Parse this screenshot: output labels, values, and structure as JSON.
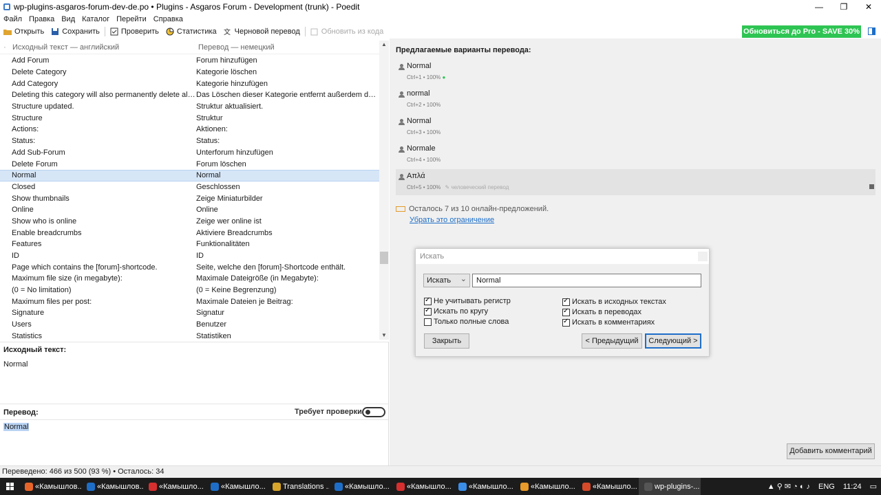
{
  "window": {
    "title": "wp-plugins-asgaros-forum-dev-de.po • Plugins - Asgaros Forum - Development (trunk) - Poedit",
    "minimize": "—",
    "maximize": "❐",
    "close": "✕"
  },
  "menu": [
    "Файл",
    "Правка",
    "Вид",
    "Каталог",
    "Перейти",
    "Справка"
  ],
  "toolbar": {
    "open": "Открыть",
    "save": "Сохранить",
    "validate": "Проверить",
    "stats": "Статистика",
    "pretranslate": "Черновой перевод",
    "update": "Обновить из кода",
    "pro": "Обновиться до Pro - SAVE 30%"
  },
  "list": {
    "header_dot": "·",
    "col_source": "Исходный текст — английский",
    "col_translation": "Перевод — немецкий",
    "rows": [
      {
        "source": "Add Forum",
        "translation": "Forum hinzufügen"
      },
      {
        "source": "Delete Category",
        "translation": "Kategorie löschen"
      },
      {
        "source": "Add Category",
        "translation": "Kategorie hinzufügen"
      },
      {
        "source": "Deleting this category will also permanently delete all for...",
        "translation": "Das Löschen dieser Kategorie entfernt außerdem dauerhaf..."
      },
      {
        "source": "Structure updated.",
        "translation": "Struktur aktualisiert."
      },
      {
        "source": "Structure",
        "translation": "Struktur"
      },
      {
        "source": "Actions:",
        "translation": "Aktionen:"
      },
      {
        "source": "Status:",
        "translation": "Status:"
      },
      {
        "source": "Add Sub-Forum",
        "translation": "Unterforum hinzufügen"
      },
      {
        "source": "Delete Forum",
        "translation": "Forum löschen"
      },
      {
        "source": "Normal",
        "translation": "Normal"
      },
      {
        "source": "Closed",
        "translation": "Geschlossen"
      },
      {
        "source": "Show thumbnails",
        "translation": "Zeige Miniaturbilder"
      },
      {
        "source": "Online",
        "translation": "Online"
      },
      {
        "source": "Show who is online",
        "translation": "Zeige wer online ist"
      },
      {
        "source": "Enable breadcrumbs",
        "translation": "Aktiviere Breadcrumbs"
      },
      {
        "source": "Features",
        "translation": "Funktionalitäten"
      },
      {
        "source": "ID",
        "translation": "ID"
      },
      {
        "source": "Page which contains the [forum]-shortcode.",
        "translation": "Seite, welche den [forum]-Shortcode enthält."
      },
      {
        "source": "Maximum file size (in megabyte):",
        "translation": "Maximale Dateigröße (in Megabyte):"
      },
      {
        "source": "(0 = No limitation)",
        "translation": "(0 = Keine Begrenzung)"
      },
      {
        "source": "Maximum files per post:",
        "translation": "Maximale Dateien je Beitrag:"
      },
      {
        "source": "Signature",
        "translation": "Signatur"
      },
      {
        "source": "Users",
        "translation": "Benutzer"
      },
      {
        "source": "Statistics",
        "translation": "Statistiken"
      }
    ],
    "selected_index": 10
  },
  "source_panel": {
    "label": "Исходный текст:",
    "text": "Normal"
  },
  "translation_panel": {
    "label": "Перевод:",
    "needs_work": "Требует проверки",
    "text": "Normal"
  },
  "status": "Переведено: 466 из 500 (93 %)  •  Осталось: 34",
  "suggestions": {
    "title": "Предлагаемые варианты перевода:",
    "items": [
      {
        "text": "Normal",
        "meta": "Ctrl+1 • 100%",
        "extra": "●",
        "human": ""
      },
      {
        "text": "normal",
        "meta": "Ctrl+2 • 100%",
        "extra": "",
        "human": ""
      },
      {
        "text": "Normal",
        "meta": "Ctrl+3 • 100%",
        "extra": "",
        "human": ""
      },
      {
        "text": "Normale",
        "meta": "Ctrl+4 • 100%",
        "extra": "",
        "human": ""
      },
      {
        "text": "Απλά",
        "meta": "Ctrl+5 • 100%",
        "extra": "",
        "human": "✎ человеческий перевод"
      }
    ],
    "online_info": "Осталось 7 из 10 онлайн-предложений.",
    "remove_limit": "Убрать это ограничение",
    "add_comment": "Добавить комментарий"
  },
  "find_dialog": {
    "title": "Искать",
    "mode": "Искать",
    "query": "Normal",
    "options_left": [
      {
        "label": "Не учитывать регистр",
        "checked": true
      },
      {
        "label": "Искать по кругу",
        "checked": true
      },
      {
        "label": "Только полные слова",
        "checked": false
      }
    ],
    "options_right": [
      {
        "label": "Искать в исходных текстах",
        "checked": true
      },
      {
        "label": "Искать в переводах",
        "checked": true
      },
      {
        "label": "Искать в комментариях",
        "checked": true
      }
    ],
    "close": "Закрыть",
    "prev": "< Предыдущий",
    "next": "Следующий >"
  },
  "taskbar": {
    "apps": [
      {
        "label": "«Камышлов...",
        "color": "#e8652a"
      },
      {
        "label": "«Камышлов...",
        "color": "#1e6ec8"
      },
      {
        "label": "«Камышло...",
        "color": "#d62f2f"
      },
      {
        "label": "«Камышло...",
        "color": "#1e6ec8"
      },
      {
        "label": "Translations ...",
        "color": "#d8a62a"
      },
      {
        "label": "«Камышло...",
        "color": "#1e6ec8"
      },
      {
        "label": "«Камышло...",
        "color": "#d62f2f"
      },
      {
        "label": "«Камышло...",
        "color": "#3a8ee8"
      },
      {
        "label": "«Камышло...",
        "color": "#e89a2a"
      },
      {
        "label": "«Камышло...",
        "color": "#d64a2a"
      },
      {
        "label": "wp-plugins-...",
        "color": "#555555"
      }
    ],
    "lang": "ENG",
    "time": "11:24"
  },
  "colors": {
    "pro_green": "#2ec453",
    "selection": "#d6e6f7",
    "link": "#1e6ec8"
  }
}
